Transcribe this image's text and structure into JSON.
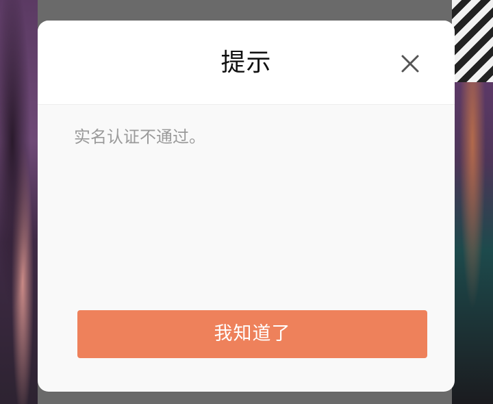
{
  "dialog": {
    "title": "提示",
    "message": "实名认证不通过。",
    "confirm_label": "我知道了",
    "close_icon": "close-icon"
  },
  "colors": {
    "confirm_button": "#ee815b",
    "dialog_background": "#f9f9f9",
    "header_background": "#ffffff",
    "message_text": "#9a9a9a",
    "title_text": "#111111"
  }
}
